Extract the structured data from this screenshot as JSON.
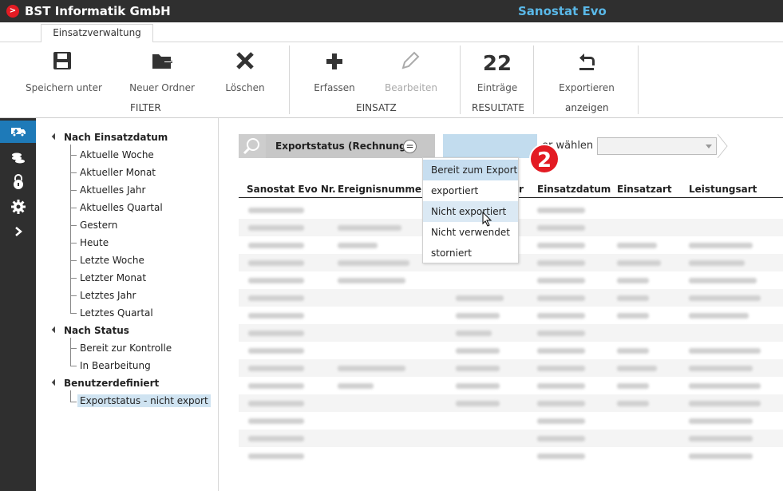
{
  "titlebar": {
    "company": "BST Informatik GmbH",
    "product": "Sanostat Evo",
    "logo_glyph": ">"
  },
  "ribbon": {
    "tab": "Einsatzverwaltung",
    "buttons": {
      "save_as": "Speichern unter",
      "new_folder": "Neuer Ordner",
      "delete": "Löschen",
      "capture": "Erfassen",
      "edit": "Bearbeiten",
      "entries_count": "22",
      "entries": "Einträge",
      "export": "Exportieren"
    },
    "groups": {
      "filter": "FILTER",
      "einsatz": "EINSATZ",
      "results": "RESULTATE",
      "show": "anzeigen"
    }
  },
  "sidebar": {
    "icons": [
      "ambulance-icon",
      "coins-icon",
      "lock-icon",
      "gear-icon",
      "chevron-right-icon"
    ]
  },
  "tree": {
    "cat1": "Nach Einsatzdatum",
    "cat1_items": [
      "Aktuelle Woche",
      "Aktueller Monat",
      "Aktuelles Jahr",
      "Aktuelles Quartal",
      "Gestern",
      "Heute",
      "Letzte Woche",
      "Letzter Monat",
      "Letztes Jahr",
      "Letztes Quartal"
    ],
    "cat2": "Nach Status",
    "cat2_items": [
      "Bereit zur Kontrolle",
      "In Bearbeitung"
    ],
    "cat3": "Benutzerdefiniert",
    "cat3_items": [
      "Exportstatus - nicht export"
    ]
  },
  "filter": {
    "field": "Exportstatus (Rechnung)",
    "operator": "=",
    "choose_label": "er wählen",
    "badge": "2"
  },
  "dropdown": {
    "options": [
      "Bereit zum Export",
      "exportiert",
      "Nicht exportiert",
      "Nicht verwendet",
      "storniert"
    ]
  },
  "grid": {
    "columns": [
      "Sanostat Evo Nr.",
      "Ereignisnummer",
      "r",
      "Einsatzdatum",
      "Einsatzart",
      "Leistungsart"
    ]
  },
  "colors": {
    "accent": "#1e7ab8",
    "brand_red": "#e31b23",
    "product_blue": "#5ab8e8",
    "highlight": "#c7def0"
  }
}
